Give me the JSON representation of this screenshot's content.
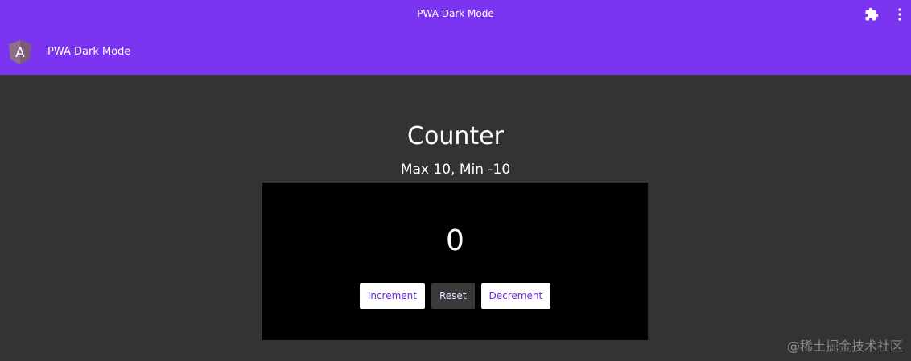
{
  "window": {
    "title": "PWA Dark Mode"
  },
  "app_bar": {
    "title": "PWA Dark Mode",
    "logo_letter": "A"
  },
  "counter": {
    "heading": "Counter",
    "limits": "Max 10, Min -10",
    "value": "0",
    "buttons": {
      "increment": "Increment",
      "reset": "Reset",
      "decrement": "Decrement"
    }
  },
  "watermark": "@稀土掘金技术社区",
  "icons": {
    "extensions": "puzzle-icon",
    "menu": "kebab-menu-icon",
    "logo": "angular-logo-icon"
  },
  "colors": {
    "primary": "#7b35f0",
    "background": "#333333",
    "panel": "#000000"
  }
}
